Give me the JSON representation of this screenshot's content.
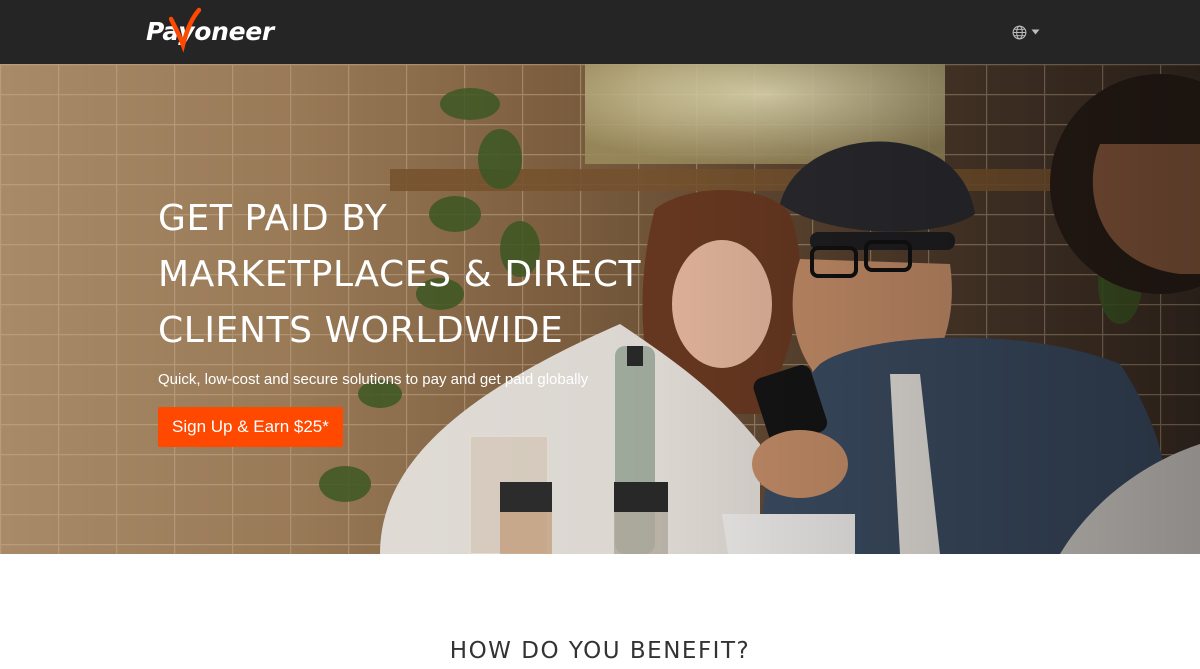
{
  "header": {
    "logo_text": "Payoneer",
    "logo_icon": "payoneer-logo",
    "language_icon": "globe-icon",
    "language_caret_icon": "caret-down-icon",
    "background_color": "#252525"
  },
  "hero": {
    "headline_lines": [
      "GET PAID BY",
      "MARKETPLACES & DIRECT",
      "CLIENTS WORLDWIDE"
    ],
    "subheadline": "Quick, low-cost and secure solutions to pay and get paid globally",
    "cta_label": "Sign Up & Earn $25*",
    "cta_color": "#ff4800",
    "background_image": "cafe-scene-photo"
  },
  "benefits": {
    "title": "HOW DO YOU BENEFIT?"
  }
}
